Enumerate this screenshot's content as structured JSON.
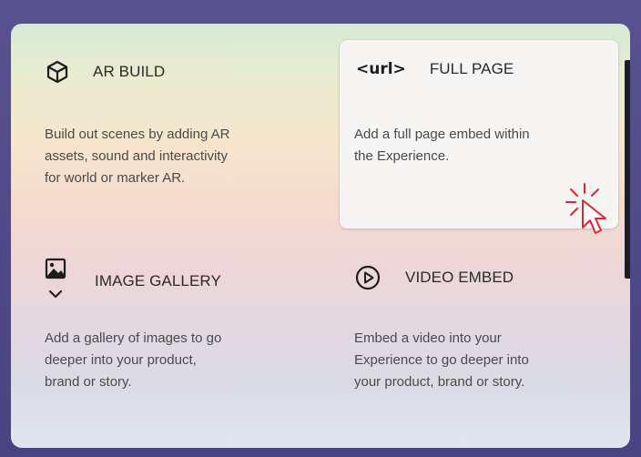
{
  "cards": [
    {
      "title": "AR BUILD",
      "icon": "cube-icon",
      "description_lines": [
        "Build out scenes by adding AR",
        "assets, sound and interactivity",
        "for world or marker AR."
      ]
    },
    {
      "title": "FULL PAGE",
      "icon": "url-code-icon",
      "icon_text": "<url>",
      "selected": true,
      "description_lines": [
        "Add a full page embed within",
        "the Experience."
      ]
    },
    {
      "title": "IMAGE GALLERY",
      "icon": "image-gallery-icon",
      "description_lines": [
        "Add a gallery of images to go",
        "deeper into your product,",
        "brand or story."
      ]
    },
    {
      "title": "VIDEO EMBED",
      "icon": "play-circle-icon",
      "description_lines": [
        "Embed a video into your",
        "Experience to go deeper into",
        "your product, brand or story."
      ]
    }
  ],
  "colors": {
    "background": "#4f4888",
    "selected_card": "#f7f5f3",
    "cursor_accent": "#e8232b",
    "text": "#2a2a2a"
  },
  "cursor": "pointer-click-icon"
}
